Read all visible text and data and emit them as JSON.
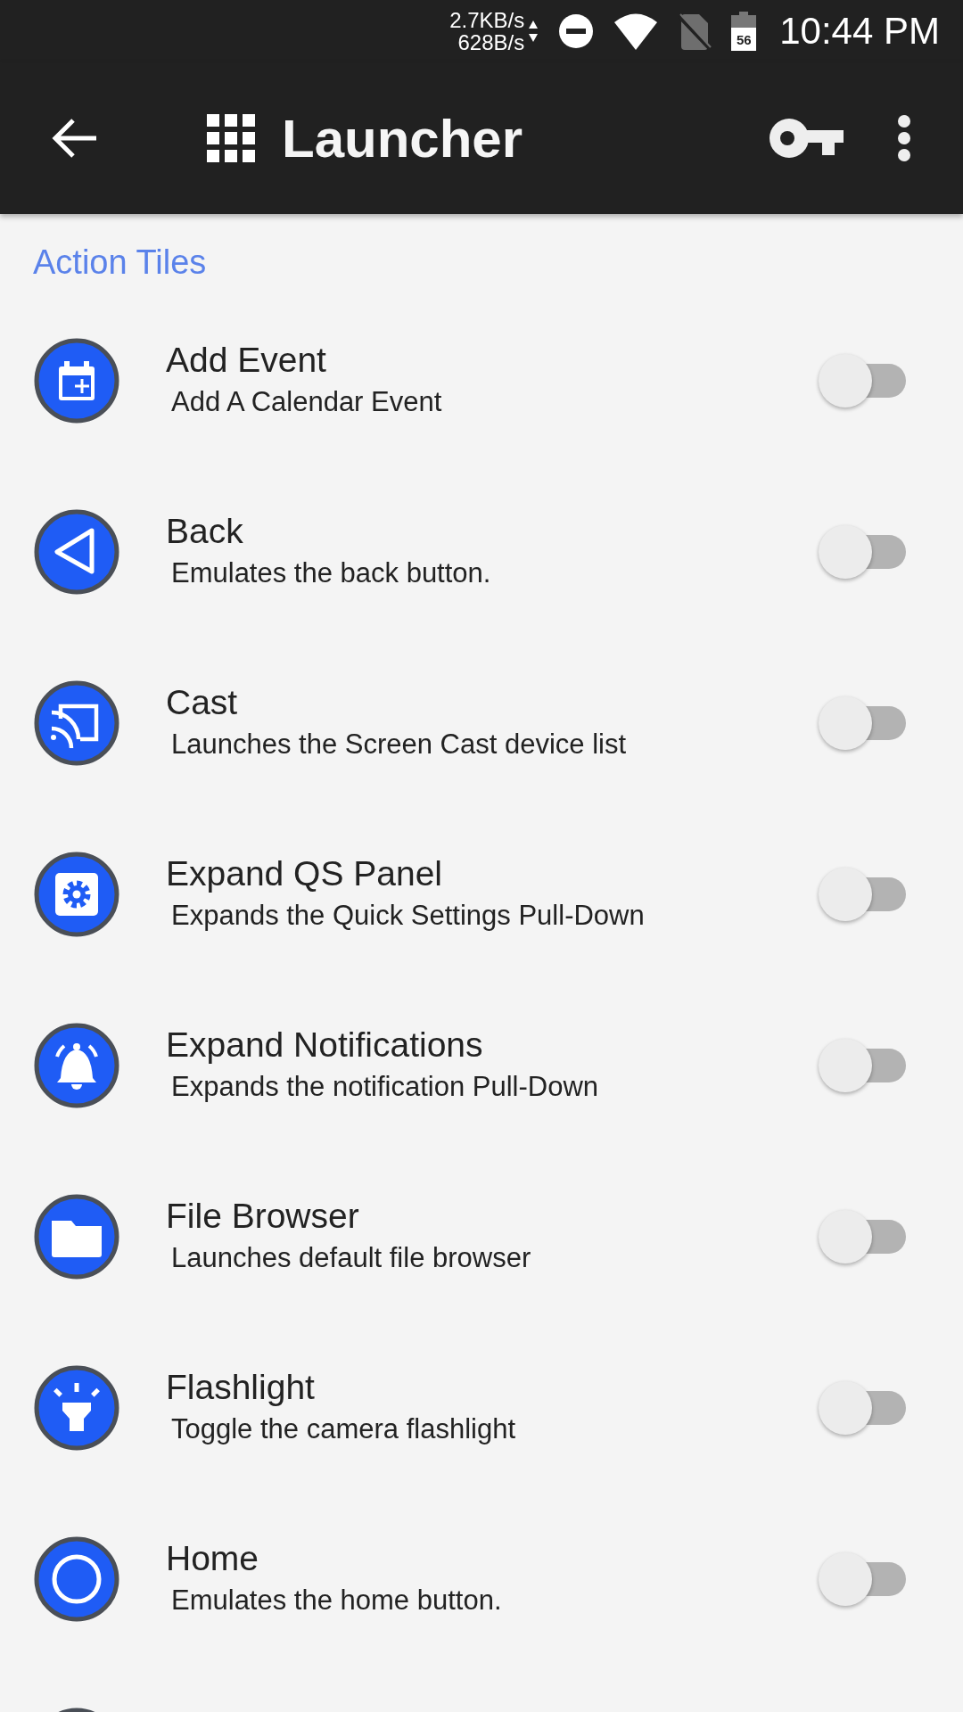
{
  "status_bar": {
    "net_up": "2.7KB/s",
    "net_down": "628B/s",
    "battery": "56",
    "time": "10:44 PM"
  },
  "app_bar": {
    "title": "Launcher"
  },
  "section": {
    "title": "Action Tiles"
  },
  "tiles": [
    {
      "kind": "calendar",
      "title": "Add Event",
      "subtitle": "Add A Calendar Event",
      "on": false
    },
    {
      "kind": "back",
      "title": "Back",
      "subtitle": "Emulates the back button.",
      "on": false
    },
    {
      "kind": "cast",
      "title": "Cast",
      "subtitle": "Launches the Screen Cast device list",
      "on": false
    },
    {
      "kind": "settings",
      "title": "Expand QS Panel",
      "subtitle": "Expands the Quick Settings Pull-Down",
      "on": false
    },
    {
      "kind": "bell",
      "title": "Expand Notifications",
      "subtitle": "Expands the notification Pull-Down",
      "on": false
    },
    {
      "kind": "folder",
      "title": "File Browser",
      "subtitle": "Launches default file browser",
      "on": false
    },
    {
      "kind": "flashlight",
      "title": "Flashlight",
      "subtitle": "Toggle the camera flashlight",
      "on": false
    },
    {
      "kind": "home",
      "title": "Home",
      "subtitle": "Emulates the home button.",
      "on": false
    },
    {
      "kind": "blank"
    }
  ]
}
